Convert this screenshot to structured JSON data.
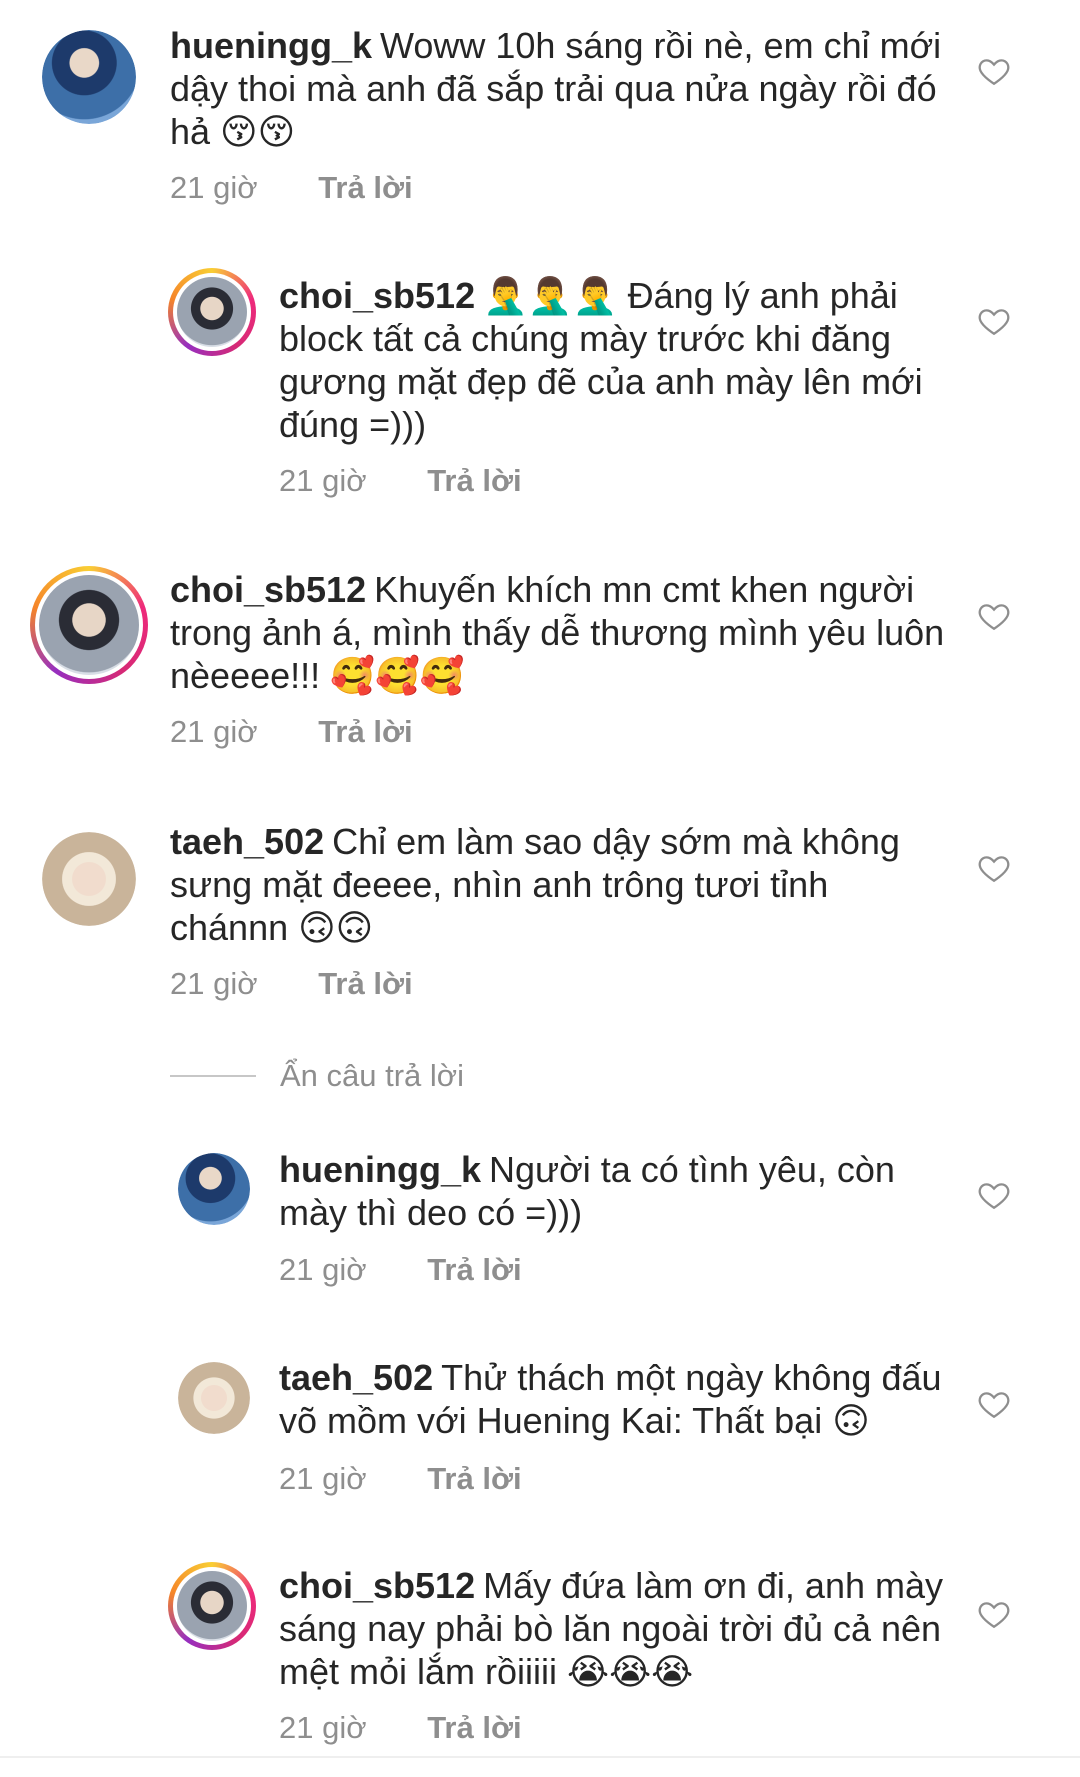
{
  "comments": [
    {
      "username": "hueningg_k",
      "text": "Woww 10h sáng rồi nè, em chỉ mới dậy thoi mà anh đã sắp trải qua nửa ngày rồi đó hả 😚😚",
      "time": "21 giờ",
      "reply": "Trả lời"
    },
    {
      "username": "choi_sb512",
      "text": "🤦‍♂️🤦‍♂️🤦‍♂️ Đáng lý anh phải block tất cả chúng mày trước khi đăng gương mặt đẹp đẽ của anh mày lên mới đúng =)))",
      "time": "21 giờ",
      "reply": "Trả lời"
    },
    {
      "username": "choi_sb512",
      "text": "Khuyến khích mn cmt khen người trong  ảnh á, mình thấy dễ thương mình yêu luôn nèeeee!!! 🥰🥰🥰",
      "time": "21 giờ",
      "reply": "Trả lời"
    },
    {
      "username": "taeh_502",
      "text": "Chỉ em làm sao dậy sớm mà không sưng mặt đeeee, nhìn anh trông tươi tỉnh chánnn 🙃🙃",
      "time": "21 giờ",
      "reply": "Trả lời"
    },
    {
      "username": "hueningg_k",
      "text": "Người ta có tình yêu, còn mày thì deo có =)))",
      "time": "21 giờ",
      "reply": "Trả lời"
    },
    {
      "username": "taeh_502",
      "text": "Thử thách một ngày không đấu võ mồm với Huening Kai: Thất bại 🙃",
      "time": "21 giờ",
      "reply": "Trả lời"
    },
    {
      "username": "choi_sb512",
      "text": "Mấy đứa làm ơn đi, anh mày sáng nay phải bò lăn ngoài trời đủ cả nên mệt mỏi lắm rồiiiii 😭😭😭",
      "time": "21 giờ",
      "reply": "Trả lời"
    }
  ],
  "hide_replies_label": "Ẩn câu trả lời",
  "icons": {
    "like": "heart-outline-icon",
    "avatar": "avatar-icon"
  },
  "colors": {
    "text": "#262626",
    "secondary": "#8e8e8e",
    "divider": "#c7c7c7"
  }
}
